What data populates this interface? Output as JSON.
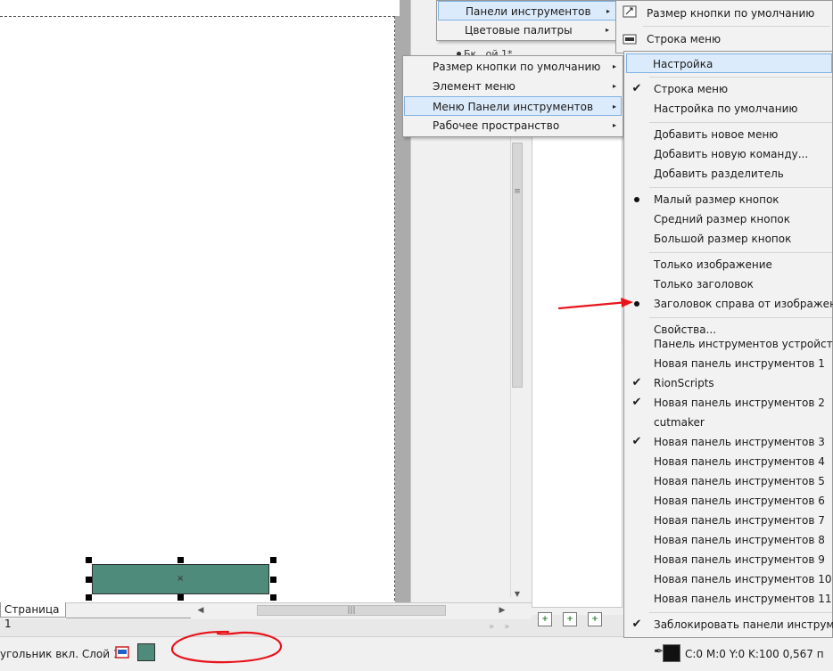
{
  "menu_panels": {
    "items": [
      {
        "label": "Панели инструментов",
        "arrow": "▸",
        "highlighted": true
      },
      {
        "label": "Цветовые палитры",
        "arrow": "▸"
      }
    ],
    "obscured_text": "Бк...ой 1*"
  },
  "submenu_customize": {
    "items": [
      {
        "label": "Размер кнопки по умолчанию",
        "arrow": "▸"
      },
      {
        "label": "Элемент меню",
        "arrow": "▸"
      },
      {
        "label": "Меню Панели инструментов",
        "arrow": "▸",
        "highlighted": true
      },
      {
        "label": "Рабочее пространство",
        "arrow": "▸"
      }
    ]
  },
  "toolbar_menu": {
    "top_items": [
      {
        "label": "Размер кнопки по умолчанию",
        "icon": "resize-icon"
      },
      {
        "label": "Строка меню",
        "icon": "menubar-icon"
      }
    ],
    "items": [
      {
        "label": "Настройка",
        "highlighted": true
      },
      {
        "label": "Строка меню",
        "checked": true
      },
      {
        "label": "Настройка по умолчанию"
      },
      {
        "label": "Добавить новое меню"
      },
      {
        "label": "Добавить новую команду..."
      },
      {
        "label": "Добавить разделитель"
      },
      {
        "label": "Малый размер кнопок",
        "selected": true
      },
      {
        "label": "Средний размер кнопок"
      },
      {
        "label": "Большой размер кнопок"
      },
      {
        "label": "Только изображение"
      },
      {
        "label": "Только заголовок"
      },
      {
        "label": "Заголовок справа от изображения",
        "selected": true
      },
      {
        "label": "Свойства..."
      }
    ]
  },
  "toolbars_list": {
    "items": [
      {
        "label": "Панель инструментов устройств с це"
      },
      {
        "label": "Новая панель инструментов 1"
      },
      {
        "label": "RionScripts",
        "checked": true
      },
      {
        "label": "Новая панель инструментов 2",
        "checked": true
      },
      {
        "label": "cutmaker"
      },
      {
        "label": "Новая панель инструментов 3",
        "checked": true
      },
      {
        "label": "Новая панель инструментов 4"
      },
      {
        "label": "Новая панель инструментов 5"
      },
      {
        "label": "Новая панель инструментов 6"
      },
      {
        "label": "Новая панель инструментов 7"
      },
      {
        "label": "Новая панель инструментов 8"
      },
      {
        "label": "Новая панель инструментов 9"
      },
      {
        "label": "Новая панель инструментов 10"
      },
      {
        "label": "Новая панель инструментов 11"
      },
      {
        "label": "Заблокировать панели инструменто",
        "checked": true
      }
    ]
  },
  "canvas": {
    "page_tab": "Страница 1",
    "shape_fill": "#4e8b7a",
    "center_mark": "×"
  },
  "status": {
    "object_info": "угольник вкл. Слой 1",
    "outline_info": "C:0 M:0 Y:0 K:100  0,567 п"
  },
  "icons": {
    "check": "✔",
    "zoom": "🔍"
  },
  "colors": {
    "highlight_bg": "#dcebfb",
    "highlight_border": "#7fb1e3",
    "annotation": "#e8141b"
  }
}
